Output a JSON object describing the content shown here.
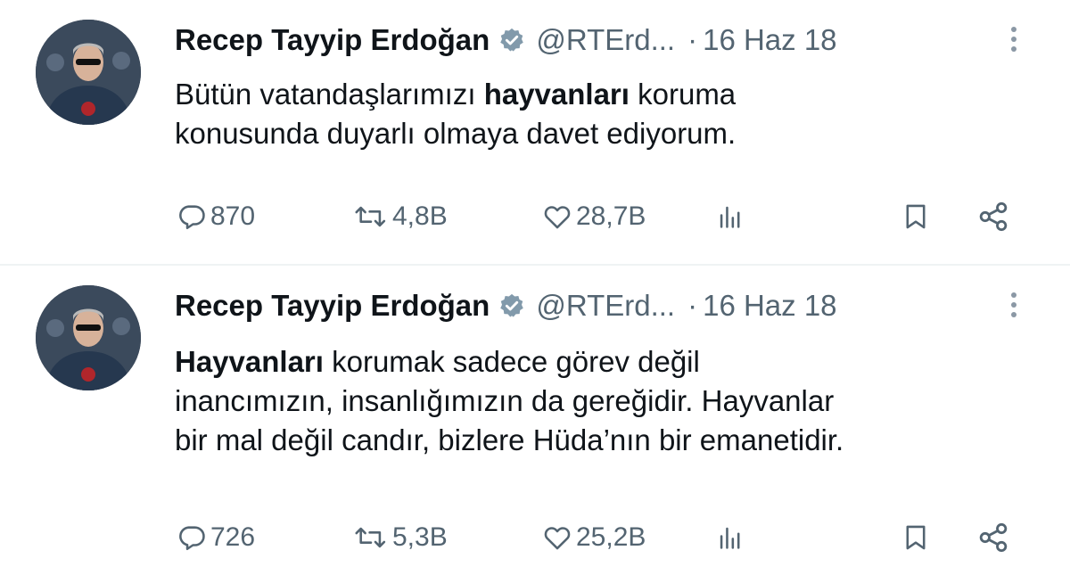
{
  "tweets": [
    {
      "author_name": "Recep Tayyip Erdoğan",
      "handle": "@RTErd...",
      "separator": "·",
      "date": "16 Haz 18",
      "text_segments": [
        {
          "text": "Bütün vatandaşlarımızı ",
          "bold": false
        },
        {
          "text": "hayvanları",
          "bold": true
        },
        {
          "text": " koruma",
          "bold": false
        },
        {
          "text": "\nkonusunda duyarlı olmaya davet ediyorum.",
          "bold": false
        }
      ],
      "replies": "870",
      "retweets": "4,8B",
      "likes": "28,7B"
    },
    {
      "author_name": "Recep Tayyip Erdoğan",
      "handle": "@RTErd...",
      "separator": "·",
      "date": "16 Haz 18",
      "text_segments": [
        {
          "text": "Hayvanları",
          "bold": true
        },
        {
          "text": " korumak sadece görev değil\ninancımızın, insanlığımızın da gereğidir. Hayvanlar\nbir mal değil candır, bizlere Hüda’nın bir emanetidir.",
          "bold": false
        }
      ],
      "replies": "726",
      "retweets": "5,3B",
      "likes": "25,2B"
    }
  ],
  "icons": {
    "verified": "verified-badge-icon",
    "more": "more-vertical-icon",
    "reply": "reply-icon",
    "retweet": "retweet-icon",
    "like": "heart-icon",
    "views": "views-chart-icon",
    "bookmark": "bookmark-icon",
    "share": "share-icon"
  },
  "colors": {
    "text_primary": "#0f1419",
    "text_secondary": "#536471",
    "verified_badge": "#829aab",
    "divider": "#eff3f4"
  }
}
